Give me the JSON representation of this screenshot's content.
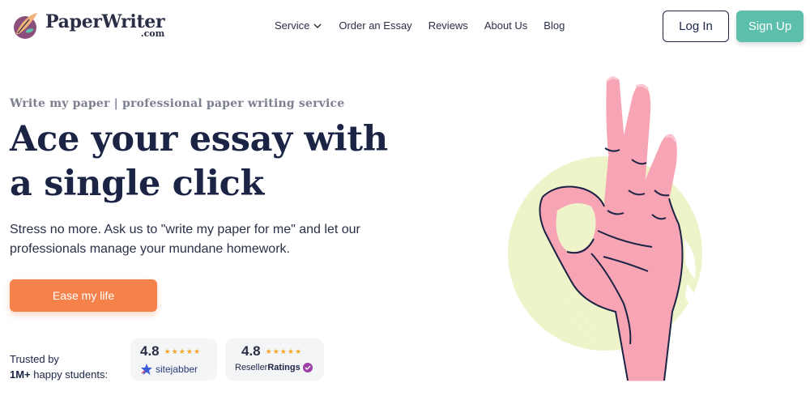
{
  "header": {
    "logo_name": "PaperWriter",
    "logo_domain": ".com",
    "nav": [
      {
        "label": "Service",
        "has_dropdown": true
      },
      {
        "label": "Order an Essay"
      },
      {
        "label": "Reviews"
      },
      {
        "label": "About Us"
      },
      {
        "label": "Blog"
      }
    ],
    "login_label": "Log In",
    "signup_label": "Sign Up"
  },
  "hero": {
    "kicker": "Write my paper | professional paper writing service",
    "headline_line1": "Ace your essay with",
    "headline_line2": "a single click",
    "subtext": "Stress no more. Ask us to \"write my paper for me\" and let our professionals manage your mundane homework.",
    "cta_label": "Ease my life"
  },
  "trust": {
    "line1": "Trusted by",
    "line2_bold": "1M+",
    "line2_rest": " happy students:",
    "ratings": [
      {
        "score": "4.8",
        "brand": "sitejabber",
        "stars": 5
      },
      {
        "score": "4.8",
        "brand_prefix": "Reseller",
        "brand_bold": "Ratings",
        "stars": 5
      }
    ]
  },
  "colors": {
    "accent_cta": "#f5824a",
    "accent_signup": "#5bbfab",
    "navy": "#1b2445",
    "hand_pink": "#f7a4b5",
    "circle": "#eef3c9"
  },
  "icons": {
    "logo": "quill-logo-icon",
    "service_dropdown": "chevron-down-icon",
    "sitejabber": "sitejabber-star-icon",
    "resellerratings": "verified-check-icon",
    "illustration": "ok-hand-illustration"
  }
}
